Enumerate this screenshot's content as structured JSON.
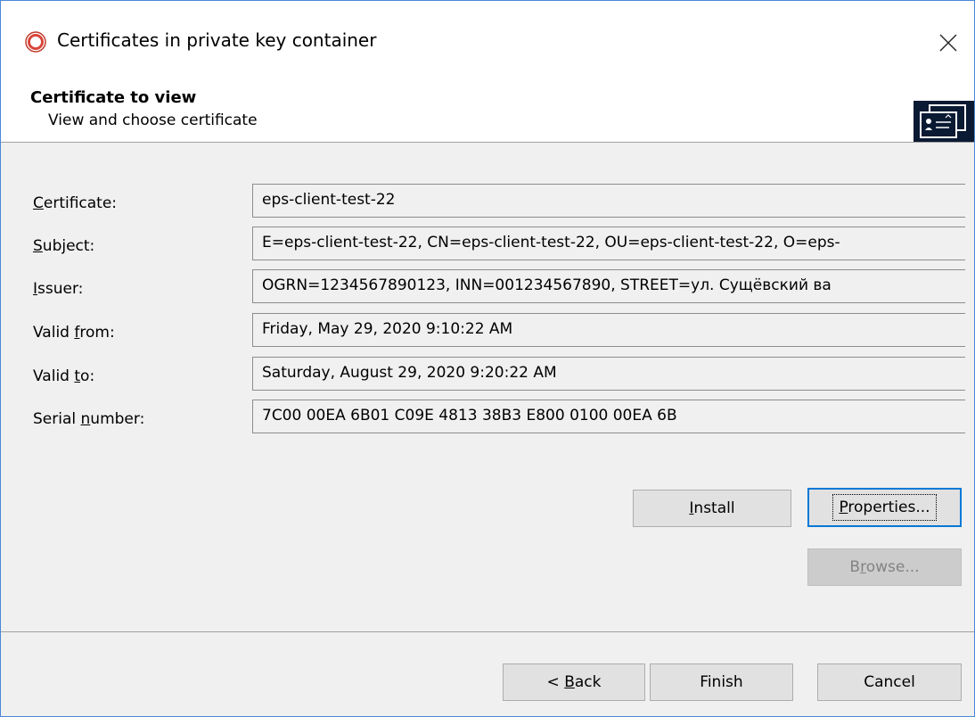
{
  "window": {
    "title": "Certificates in private key container",
    "close_glyph": "✕"
  },
  "header": {
    "title": "Certificate to view",
    "subtitle": "View and choose certificate"
  },
  "fields": [
    {
      "label_key": "C",
      "label_rest": "ertificate:",
      "value": "eps-client-test-22"
    },
    {
      "label_key": "S",
      "label_rest": "ubject:",
      "value": "E=eps-client-test-22, CN=eps-client-test-22, OU=eps-client-test-22, O=eps-"
    },
    {
      "label_key": "I",
      "label_rest": "ssuer:",
      "value": "OGRN=1234567890123, INN=001234567890, STREET=ул. Сущёвский ва"
    },
    {
      "label_pre": "Valid ",
      "label_key": "f",
      "label_rest": "rom:",
      "value": "Friday, May 29, 2020 9:10:22 AM"
    },
    {
      "label_pre": "Valid ",
      "label_key": "t",
      "label_rest": "o:",
      "value": "Saturday, August 29, 2020 9:20:22 AM"
    },
    {
      "label_pre": "Serial ",
      "label_key": "n",
      "label_rest": "umber:",
      "value": "7C00 00EA 6B01 C09E 4813 38B3 E800 0100 00EA 6B"
    }
  ],
  "buttons": {
    "install": {
      "key": "I",
      "rest": "nstall"
    },
    "properties": {
      "key": "P",
      "rest": "roperties..."
    },
    "browse": {
      "pre": "B",
      "key": "r",
      "rest": "owse..."
    },
    "back": {
      "pre": "< ",
      "key": "B",
      "rest": "ack"
    },
    "finish": {
      "label": "Finish"
    },
    "cancel": {
      "label": "Cancel"
    }
  },
  "icons": {
    "app": "cryptopro-logo-icon",
    "header": "certificate-cards-icon",
    "close": "close-icon"
  }
}
